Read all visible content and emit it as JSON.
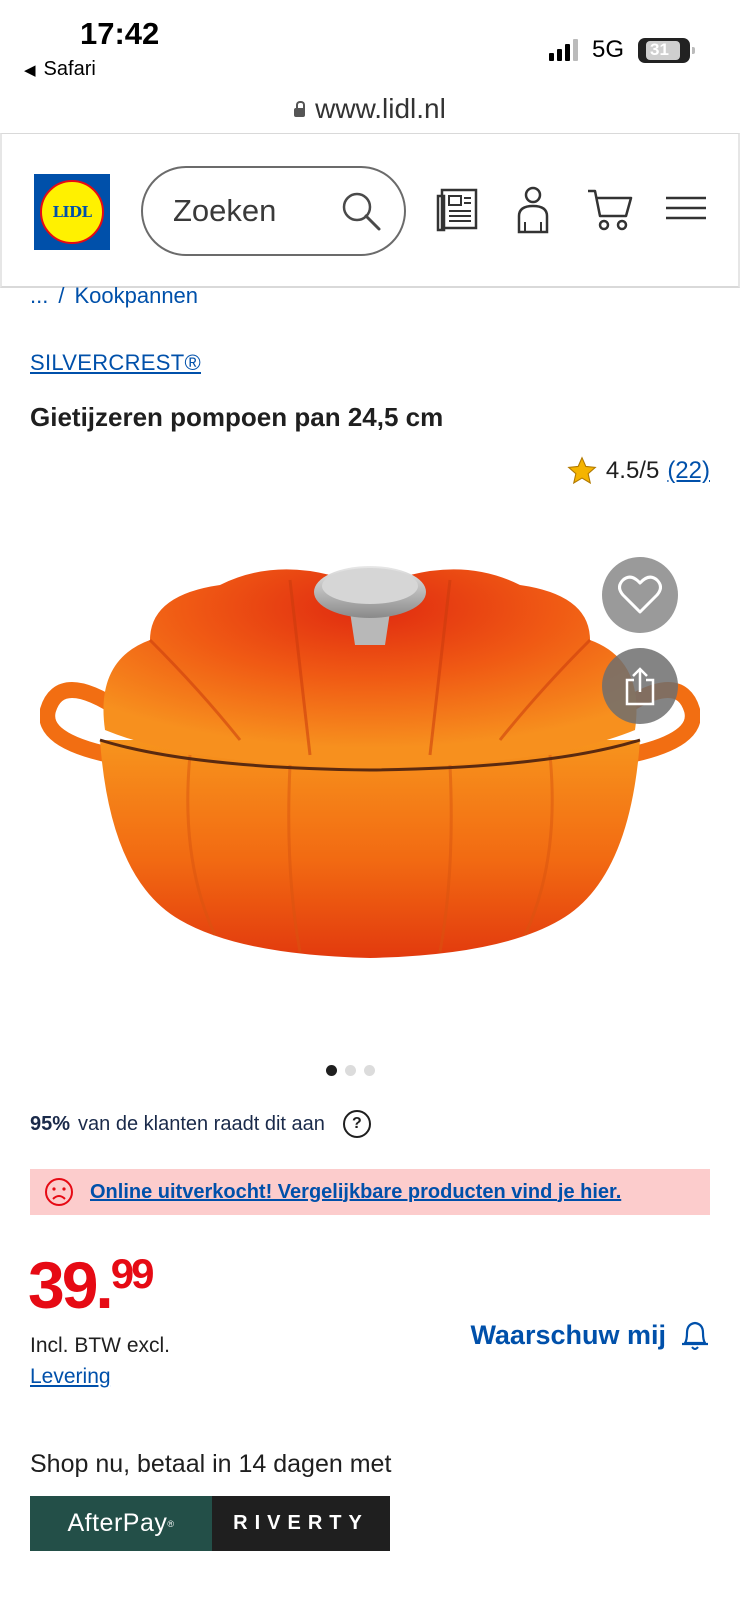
{
  "status_bar": {
    "time": "17:42",
    "back_app": "Safari",
    "network": "5G",
    "battery": "31"
  },
  "browser": {
    "url": "www.lidl.nl"
  },
  "header": {
    "logo_text": "LIDL",
    "search_placeholder": "Zoeken",
    "icons": [
      "brochure-icon",
      "account-icon",
      "cart-icon",
      "menu-icon"
    ]
  },
  "breadcrumb": {
    "ellipsis": "...",
    "separator": "/",
    "current": "Kookpannen"
  },
  "product": {
    "brand": "SILVERCREST®",
    "title": "Gietijzeren pompoen pan 24,5 cm",
    "rating": "4.5/5",
    "rating_count": "(22)",
    "rating_stars": 4.5,
    "image_count": 3,
    "image_active": 1,
    "recommend_percent": "95%",
    "recommend_text": "van de klanten raadt dit aan",
    "soldout_message": "Online uitverkocht! Vergelijkbare producten vind je hier.",
    "price_main": "39",
    "price_sep": ".",
    "price_cents": "99",
    "tax_note": "Incl. BTW excl.",
    "delivery_link": "Levering",
    "notify_label": "Waarschuw mij"
  },
  "payment": {
    "intro": "Shop nu, betaal in 14 dagen met",
    "afterpay_label": "AfterPay",
    "riverty_label": "RIVERTY"
  },
  "colors": {
    "brand_blue": "#0050aa",
    "price_red": "#e60a14",
    "soldout_bg": "#fccccc",
    "afterpay_bg": "#234f48"
  }
}
